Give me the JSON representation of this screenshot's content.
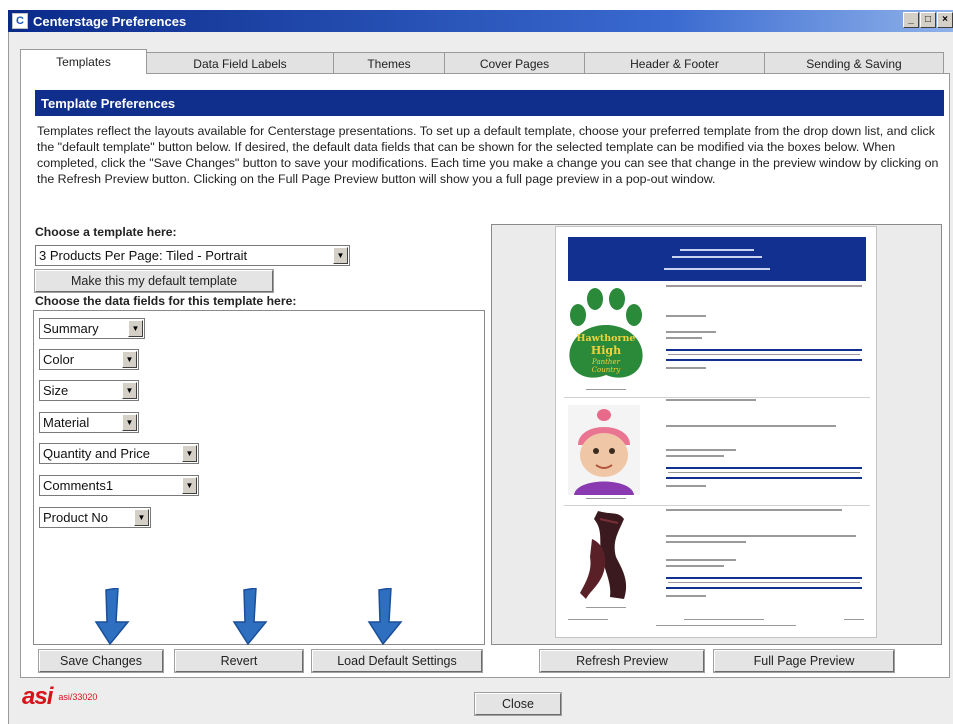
{
  "window": {
    "title": "Centerstage Preferences",
    "controls": {
      "minimize": "_",
      "maximize": "□",
      "close": "×"
    }
  },
  "tabs": [
    {
      "label": "Templates",
      "active": true
    },
    {
      "label": "Data Field Labels",
      "active": false
    },
    {
      "label": "Themes",
      "active": false
    },
    {
      "label": "Cover Pages",
      "active": false
    },
    {
      "label": "Header & Footer",
      "active": false
    },
    {
      "label": "Sending & Saving",
      "active": false
    }
  ],
  "section": {
    "title": "Template Preferences",
    "description": "Templates reflect the layouts available for Centerstage presentations. To set up a default template, choose your preferred template from the drop down list, and click the \"default template\" button below. If desired, the default data fields that can be shown for the selected template can be modified via the boxes below. When completed, click the \"Save Changes\" button to save your modifications. Each time you make a change you can see that change in the preview window by clicking on the Refresh Preview button. Clicking on the Full Page Preview button will show you a full page preview in a pop-out window."
  },
  "template": {
    "choose_label": "Choose a template here:",
    "selected": "3 Products Per Page: Tiled - Portrait",
    "default_button": "Make this my default template"
  },
  "fields": {
    "choose_label": "Choose the data fields for this template here:",
    "items": [
      "Summary",
      "Color",
      "Size",
      "Material",
      "Quantity and Price",
      "Comments1",
      "Product No"
    ]
  },
  "preview": {
    "products": [
      {
        "image": "paw-print-logo-product",
        "logo_text": [
          "Hawthorne",
          "High",
          "Panther",
          "Country"
        ]
      },
      {
        "image": "baby-hat-product"
      },
      {
        "image": "scarf-product"
      }
    ]
  },
  "buttons": {
    "save": "Save Changes",
    "revert": "Revert",
    "load_default": "Load Default Settings",
    "refresh_preview": "Refresh Preview",
    "full_page_preview": "Full Page Preview",
    "close": "Close"
  },
  "brand": {
    "logo": "asi",
    "code": "asi/33020",
    "color": "#d8121b"
  },
  "colors": {
    "header_blue": "#102e8c",
    "arrow_blue": "#2e6fc0"
  }
}
